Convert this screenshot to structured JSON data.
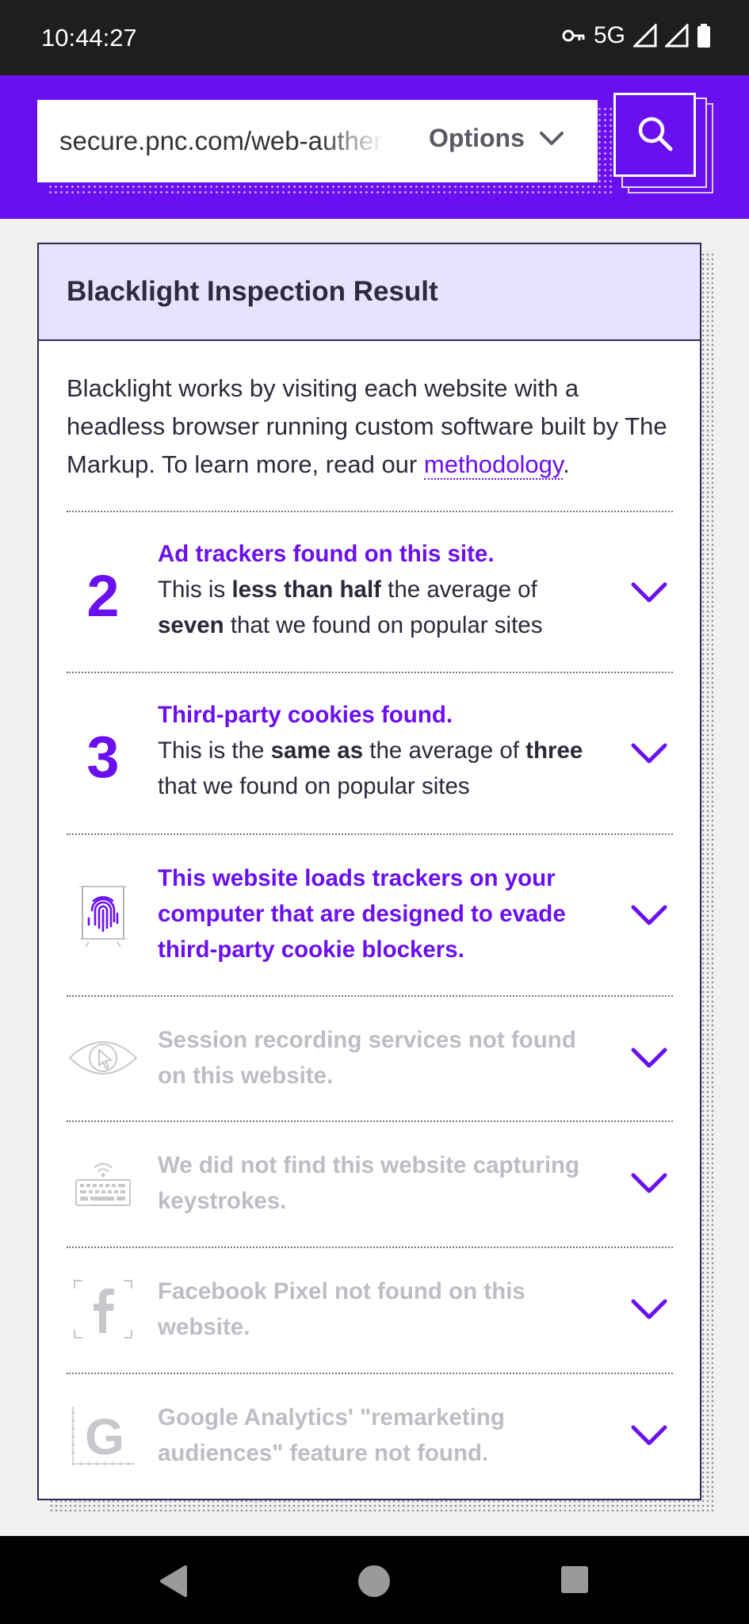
{
  "status_bar": {
    "time": "10:44:27",
    "network": "5G",
    "icons": [
      "key-icon",
      "signal-icon",
      "signal-icon",
      "battery-icon"
    ]
  },
  "search": {
    "url": "secure.pnc.com/web-authentication",
    "options_label": "Options",
    "search_icon": "search-icon"
  },
  "result": {
    "title": "Blacklight Inspection Result",
    "intro_text": "Blacklight works by visiting each website with a headless browser running custom software built by The Markup. To learn more, read our ",
    "intro_link": "methodology",
    "intro_end": ".",
    "ad_trackers": {
      "count": "2",
      "title": "Ad trackers found on this site.",
      "desc_1": "This is ",
      "desc_bold_1": "less than half",
      "desc_2": " the average of ",
      "desc_bold_2": "seven",
      "desc_3": " that we found on popular sites"
    },
    "cookies": {
      "count": "3",
      "title": "Third-party cookies found.",
      "desc_1": "This is the ",
      "desc_bold_1": "same as",
      "desc_2": " the average of ",
      "desc_bold_2": "three",
      "desc_3": " that we found on popular sites"
    },
    "fingerprinting": {
      "title": "This website loads trackers on your computer that are designed to evade third-party cookie blockers.",
      "icon": "fingerprint-icon"
    },
    "session_recording": {
      "title": "Session recording services not found on this website.",
      "icon": "eye-icon"
    },
    "keystrokes": {
      "title": "We did not find this website capturing keystrokes.",
      "icon": "keyboard-icon"
    },
    "facebook": {
      "title": "Facebook Pixel not found on this website.",
      "icon": "facebook-icon"
    },
    "google": {
      "title": "Google Analytics' \"remarketing audiences\" feature not found.",
      "icon": "google-icon"
    }
  },
  "colors": {
    "accent": "#6a10f0",
    "header_tint": "#e8e2fd",
    "muted_text": "#bdbdc4"
  },
  "nav_bar": {
    "icons": [
      "back-icon",
      "home-icon",
      "recents-icon"
    ]
  }
}
